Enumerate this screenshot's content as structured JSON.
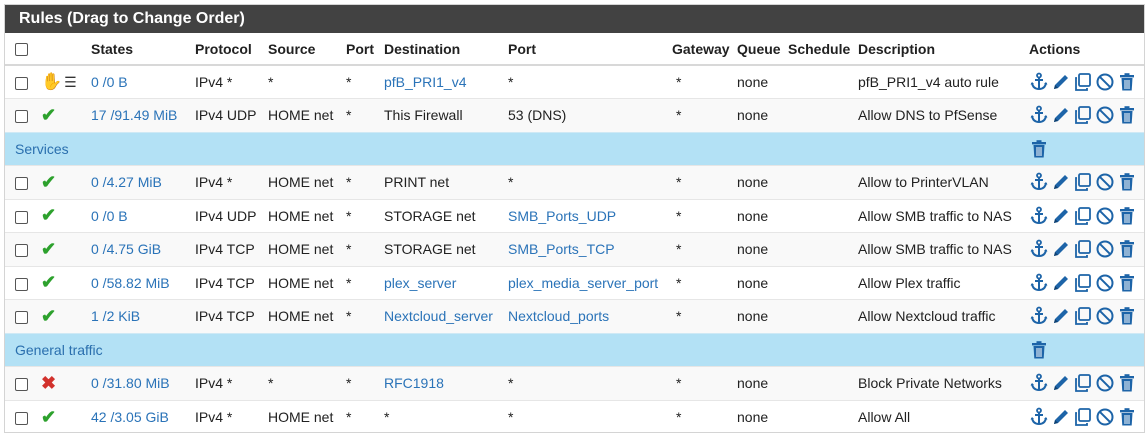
{
  "panel": {
    "title": "Rules (Drag to Change Order)"
  },
  "columns": {
    "states": "States",
    "protocol": "Protocol",
    "source": "Source",
    "port": "Port",
    "destination": "Destination",
    "dport": "Port",
    "gateway": "Gateway",
    "queue": "Queue",
    "schedule": "Schedule",
    "description": "Description",
    "actions": "Actions"
  },
  "colors": {
    "header_bg": "#424242",
    "separator_bg": "#b3e1f5",
    "link": "#2a73b8",
    "pass": "#2da12d",
    "block": "#d2322d",
    "action_icon": "#1d64a8"
  },
  "rows": [
    {
      "type": "rule",
      "status": "hand-list",
      "states": "0 /0 B",
      "protocol": "IPv4 *",
      "source": "*",
      "sport": "*",
      "destination": "pfB_PRI1_v4",
      "dest_link": true,
      "dport": "*",
      "dport_link": false,
      "gateway": "*",
      "queue": "none",
      "schedule": "",
      "description": "pfB_PRI1_v4 auto rule"
    },
    {
      "type": "rule",
      "status": "pass",
      "states": "17 /91.49 MiB",
      "protocol": "IPv4 UDP",
      "source": "HOME net",
      "sport": "*",
      "destination": "This Firewall",
      "dest_link": false,
      "dport": "53 (DNS)",
      "dport_link": false,
      "gateway": "*",
      "queue": "none",
      "schedule": "",
      "description": "Allow DNS to PfSense"
    },
    {
      "type": "separator",
      "label": "Services"
    },
    {
      "type": "rule",
      "status": "pass",
      "states": "0 /4.27 MiB",
      "protocol": "IPv4 *",
      "source": "HOME net",
      "sport": "*",
      "destination": "PRINT net",
      "dest_link": false,
      "dport": "*",
      "dport_link": false,
      "gateway": "*",
      "queue": "none",
      "schedule": "",
      "description": "Allow to PrinterVLAN"
    },
    {
      "type": "rule",
      "status": "pass",
      "states": "0 /0 B",
      "protocol": "IPv4 UDP",
      "source": "HOME net",
      "sport": "*",
      "destination": "STORAGE net",
      "dest_link": false,
      "dport": "SMB_Ports_UDP",
      "dport_link": true,
      "gateway": "*",
      "queue": "none",
      "schedule": "",
      "description": "Allow SMB traffic to NAS"
    },
    {
      "type": "rule",
      "status": "pass",
      "states": "0 /4.75 GiB",
      "protocol": "IPv4 TCP",
      "source": "HOME net",
      "sport": "*",
      "destination": "STORAGE net",
      "dest_link": false,
      "dport": "SMB_Ports_TCP",
      "dport_link": true,
      "gateway": "*",
      "queue": "none",
      "schedule": "",
      "description": "Allow SMB traffic to NAS"
    },
    {
      "type": "rule",
      "status": "pass",
      "states": "0 /58.82 MiB",
      "protocol": "IPv4 TCP",
      "source": "HOME net",
      "sport": "*",
      "destination": "plex_server",
      "dest_link": true,
      "dport": "plex_media_server_port",
      "dport_link": true,
      "gateway": "*",
      "queue": "none",
      "schedule": "",
      "description": "Allow Plex traffic"
    },
    {
      "type": "rule",
      "status": "pass",
      "states": "1 /2 KiB",
      "protocol": "IPv4 TCP",
      "source": "HOME net",
      "sport": "*",
      "destination": "Nextcloud_server",
      "dest_link": true,
      "dport": "Nextcloud_ports",
      "dport_link": true,
      "gateway": "*",
      "queue": "none",
      "schedule": "",
      "description": "Allow Nextcloud traffic"
    },
    {
      "type": "separator",
      "label": "General traffic"
    },
    {
      "type": "rule",
      "status": "block",
      "states": "0 /31.80 MiB",
      "protocol": "IPv4 *",
      "source": "*",
      "sport": "*",
      "destination": "RFC1918",
      "dest_link": true,
      "dport": "*",
      "dport_link": false,
      "gateway": "*",
      "queue": "none",
      "schedule": "",
      "description": "Block Private Networks"
    },
    {
      "type": "rule",
      "status": "pass",
      "states": "42 /3.05 GiB",
      "protocol": "IPv4 *",
      "source": "HOME net",
      "sport": "*",
      "destination": "*",
      "dest_link": false,
      "dport": "*",
      "dport_link": false,
      "gateway": "*",
      "queue": "none",
      "schedule": "",
      "description": "Allow All"
    }
  ]
}
